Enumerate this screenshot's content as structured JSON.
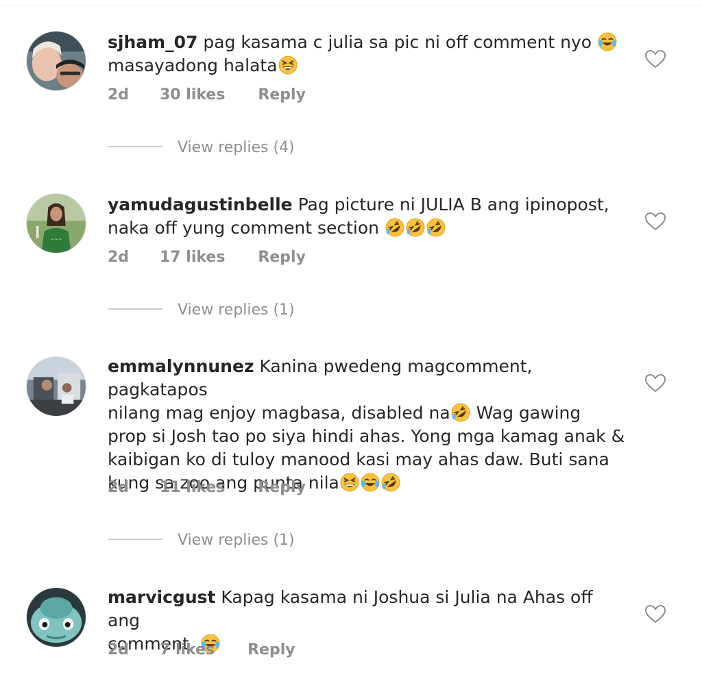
{
  "comments": [
    {
      "username": "sjham_07",
      "text_parts": [
        "pag kasama c julia sa pic ni off comment nyo ",
        "masayadong halata"
      ],
      "time": "2d",
      "likes": "30 likes",
      "reply": "Reply",
      "view_replies": "View replies (4)"
    },
    {
      "username": "yamudagustinbelle",
      "text_parts": [
        "Pag picture ni JULIA B ang ipinopost, ",
        "naka off yung comment section "
      ],
      "time": "2d",
      "likes": "17 likes",
      "reply": "Reply",
      "view_replies": "View replies (1)"
    },
    {
      "username": "emmalynnunez",
      "text_parts": [
        "Kanina pwedeng magcomment, pagkatapos ",
        "nilang mag enjoy magbasa, disabled na",
        " Wag gawing ",
        "prop si Josh tao po siya hindi ahas. Yong mga kamag anak & ",
        "kaibigan ko di tuloy manood kasi may ahas daw. Buti sana ",
        "kung sa zoo ang punta nila"
      ],
      "time": "2d",
      "likes": "11 likes",
      "reply": "Reply",
      "view_replies": "View replies (1)"
    },
    {
      "username": "marvicgust",
      "text_parts": [
        "Kapag kasama ni Joshua si Julia na Ahas off ang ",
        "comment. "
      ],
      "time": "2d",
      "likes": "7 likes",
      "reply": "Reply"
    }
  ],
  "icons": {
    "heart": "heart-outline-icon",
    "tears_of_joy": "face-with-tears-of-joy",
    "rofl": "rolling-on-the-floor-laughing",
    "grinning_squinting": "grinning-squinting-face"
  },
  "colors": {
    "text": "#262626",
    "meta": "#8e8e8e",
    "emoji_yellow": "#f9c23c"
  }
}
